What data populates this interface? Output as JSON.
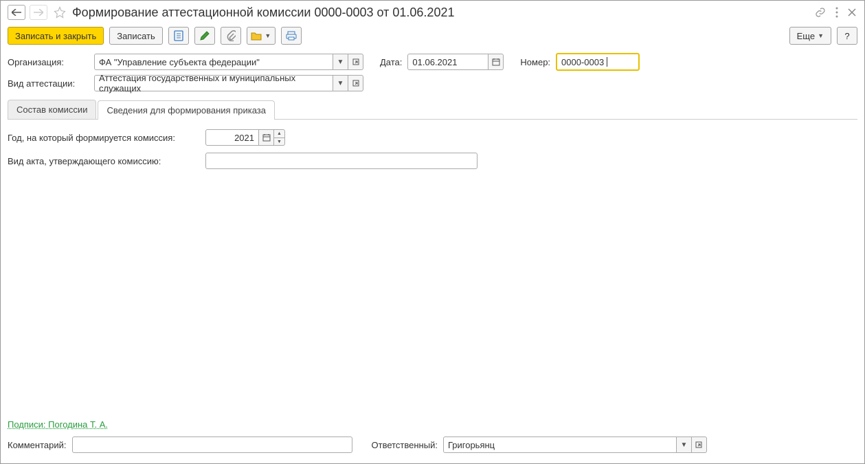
{
  "title": "Формирование аттестационной комиссии 0000-0003 от 01.06.2021",
  "toolbar": {
    "save_close": "Записать и закрыть",
    "save": "Записать",
    "more": "Еще",
    "help": "?"
  },
  "org": {
    "label": "Организация:",
    "value": "ФА \"Управление субъекта федерации\""
  },
  "date": {
    "label": "Дата:",
    "value": "01.06.2021"
  },
  "number": {
    "label": "Номер:",
    "value": "0000-0003"
  },
  "attest": {
    "label": "Вид аттестации:",
    "value": "Аттестация государственных и муниципальных служащих"
  },
  "tabs": {
    "composition": "Состав комиссии",
    "order_info": "Сведения для формирования приказа"
  },
  "order": {
    "year_label": "Год, на который формируется комиссия:",
    "year_value": "2021",
    "act_label": "Вид акта, утверждающего комиссию:",
    "act_value": ""
  },
  "signatures": "Подписи: Погодина Т. А.",
  "footer": {
    "comment_label": "Комментарий:",
    "comment_value": "",
    "responsible_label": "Ответственный:",
    "responsible_value": "Григорьянц"
  }
}
